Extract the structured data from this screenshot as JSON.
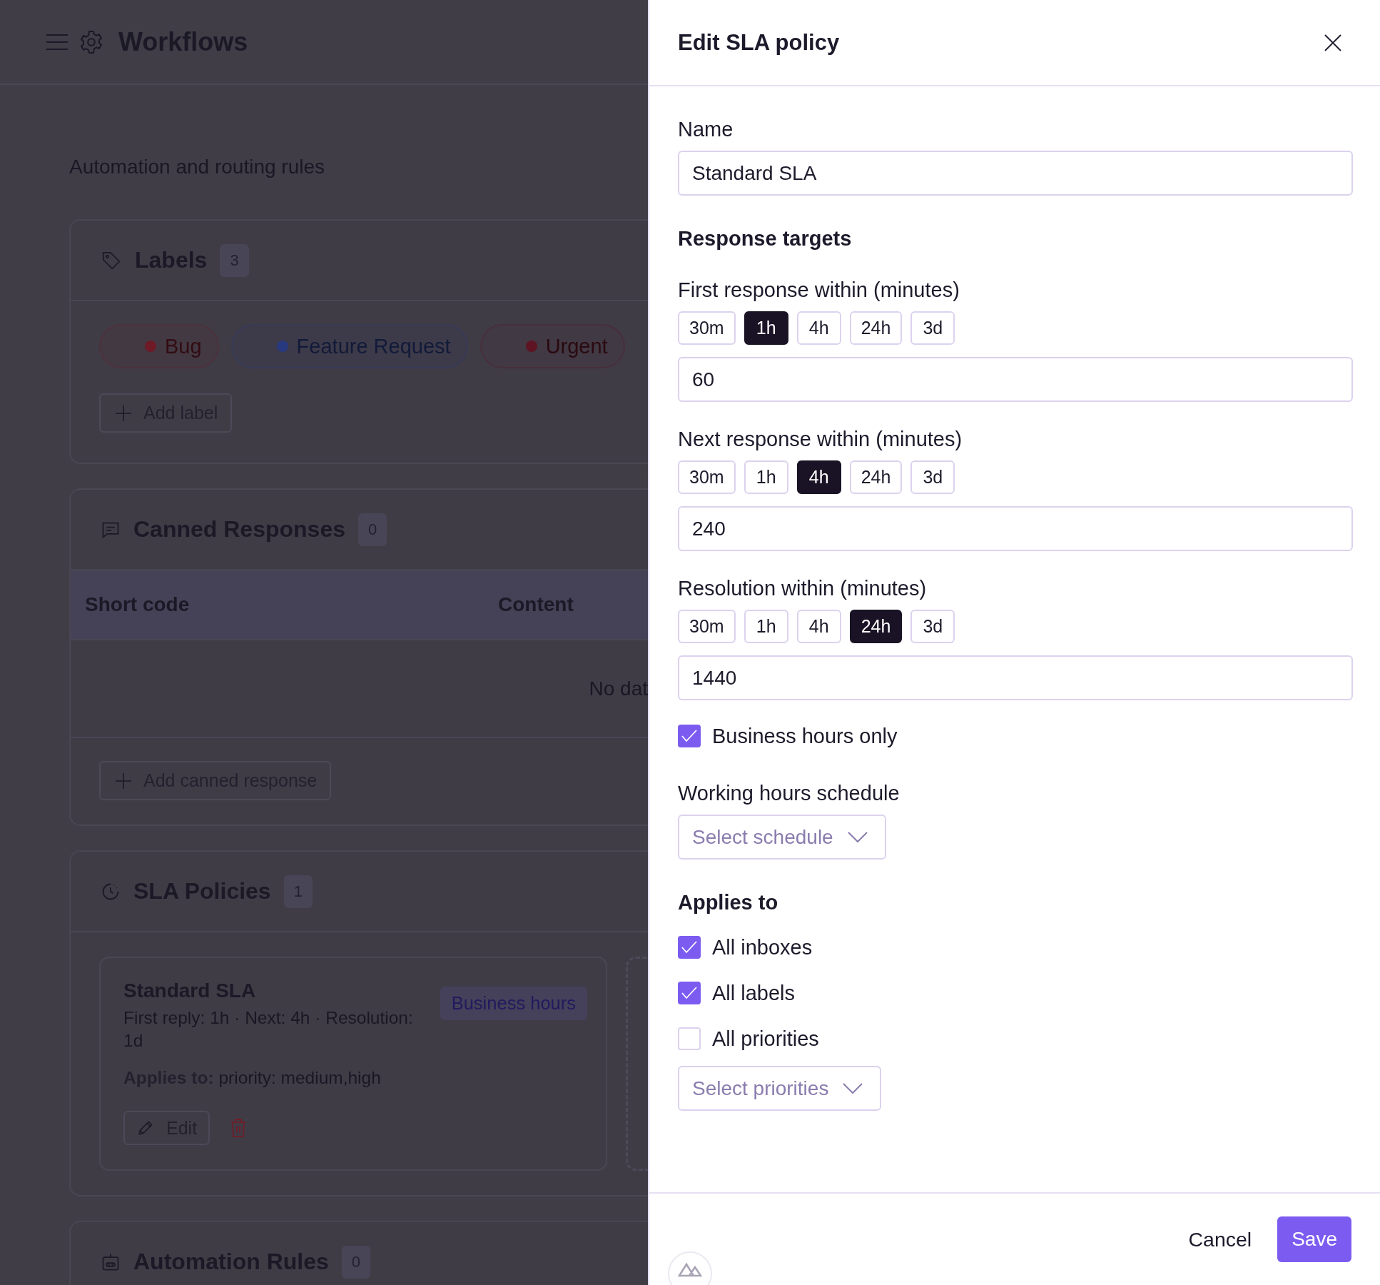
{
  "app_header": {
    "title": "Workflows"
  },
  "subtitle": "Automation and routing rules",
  "sections": [
    {
      "kind": "labels",
      "title": "Labels",
      "count": "3",
      "labels": [
        {
          "name": "Bug",
          "color": "#6e1a27"
        },
        {
          "name": "Feature Request",
          "color": "#29397f"
        },
        {
          "name": "Urgent",
          "color": "#5f1423"
        }
      ],
      "add_button": "Add label"
    },
    {
      "kind": "table",
      "title": "Canned Responses",
      "count": "0",
      "columns": [
        "Short code",
        "Content"
      ],
      "empty_text": "No dat",
      "add_button": "Add canned response"
    },
    {
      "kind": "policies",
      "title": "SLA Policies",
      "count": "1",
      "policies": [
        {
          "name": "Standard SLA",
          "summary": "First reply: 1h · Next: 4h · Resolution: 1d",
          "tag": "Business hours",
          "applies": "**Applies to:** priority: medium,high",
          "edit_button": "Edit"
        }
      ]
    },
    {
      "kind": "rules",
      "title": "Automation Rules",
      "count": "0"
    }
  ],
  "dialog": {
    "title": "Edit SLA policy",
    "name_label": "Name",
    "name_value": "Standard SLA",
    "targets_title": "Response targets",
    "targets": [
      {
        "label": "First response within (minutes)",
        "value": "60",
        "presets": [
          {
            "label": "30m",
            "selected": false
          },
          {
            "label": "1h",
            "selected": true
          },
          {
            "label": "4h",
            "selected": false
          },
          {
            "label": "24h",
            "selected": false
          },
          {
            "label": "3d",
            "selected": false
          }
        ]
      },
      {
        "label": "Next response within (minutes)",
        "value": "240",
        "presets": [
          {
            "label": "30m",
            "selected": false
          },
          {
            "label": "1h",
            "selected": false
          },
          {
            "label": "4h",
            "selected": true
          },
          {
            "label": "24h",
            "selected": false
          },
          {
            "label": "3d",
            "selected": false
          }
        ]
      },
      {
        "label": "Resolution within (minutes)",
        "value": "1440",
        "presets": [
          {
            "label": "30m",
            "selected": false
          },
          {
            "label": "1h",
            "selected": false
          },
          {
            "label": "4h",
            "selected": false
          },
          {
            "label": "24h",
            "selected": true
          },
          {
            "label": "3d",
            "selected": false
          }
        ]
      }
    ],
    "business_hours": {
      "label": "Business hours only",
      "checked": true
    },
    "schedule": {
      "label": "Working hours schedule",
      "placeholder": "Select schedule"
    },
    "applies_title": "Applies to",
    "applies": [
      {
        "label": "All inboxes",
        "checked": true
      },
      {
        "label": "All labels",
        "checked": true
      },
      {
        "label": "All priorities",
        "checked": false
      }
    ],
    "priorities": {
      "placeholder": "Select priorities"
    },
    "cancel_button": "Cancel",
    "save_button": "Save"
  }
}
